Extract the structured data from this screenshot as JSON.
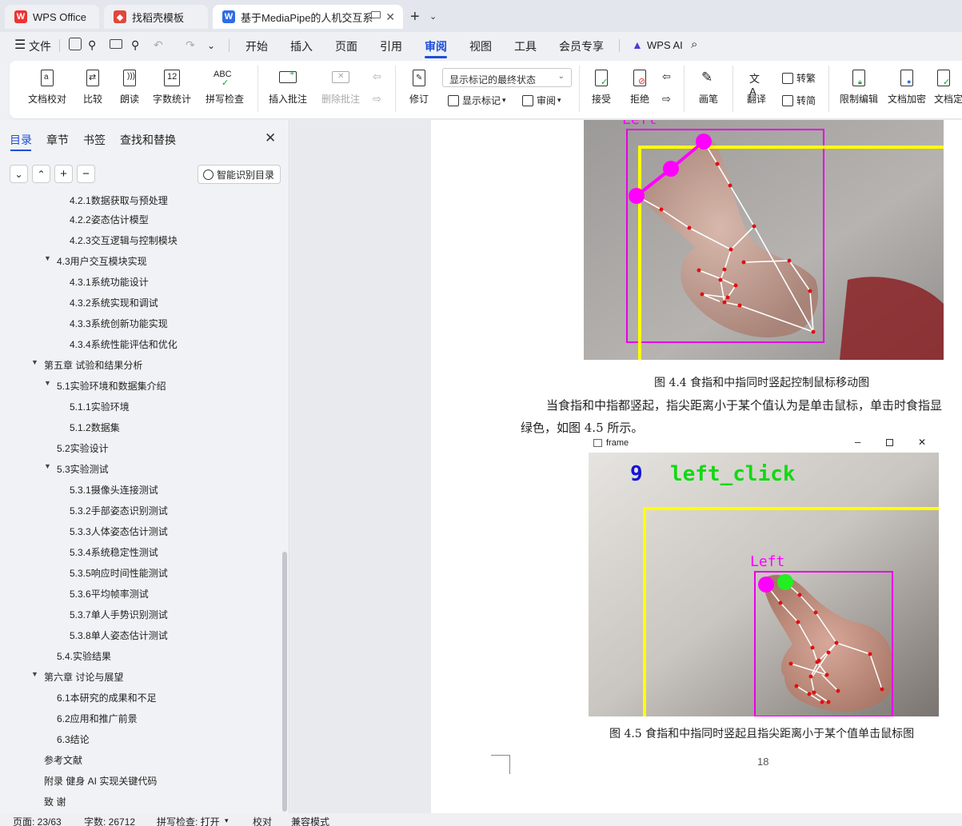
{
  "tabs": [
    {
      "label": "WPS Office",
      "icon": "wps-logo-icon"
    },
    {
      "label": "找稻壳模板",
      "icon": "docer-icon"
    },
    {
      "label": "基于MediaPipe的人机交互系",
      "icon": "word-doc-icon"
    }
  ],
  "menu": {
    "file": "文件",
    "items": [
      "开始",
      "插入",
      "页面",
      "引用",
      "审阅",
      "视图",
      "工具",
      "会员专享"
    ],
    "active": "审阅",
    "wps_ai": "WPS AI"
  },
  "ribbon": {
    "doc_check": "文档校对",
    "compare": "比较",
    "read_aloud": "朗读",
    "word_count": "字数统计",
    "spell_check": "拼写检查",
    "spell_icon_text": "ABC",
    "word_count_icon_text": "12",
    "insert_comment": "插入批注",
    "delete_comment": "删除批注",
    "track_changes": "修订",
    "display_mode": "显示标记的最终状态",
    "show_markup": "显示标记",
    "review": "审阅",
    "accept": "接受",
    "reject": "拒绝",
    "pen": "画笔",
    "translate": "翻译",
    "to_traditional": "转繁",
    "to_simplified": "转简",
    "restrict_edit": "限制编辑",
    "encrypt": "文档加密",
    "finalize": "文档定"
  },
  "side_panel": {
    "tabs": [
      "目录",
      "章节",
      "书签",
      "查找和替换"
    ],
    "active_tab": "目录",
    "smart_toc": "智能识别目录",
    "toc": [
      {
        "text": "4.2.1数据获取与预处理",
        "level": 3
      },
      {
        "text": "4.2.2姿态估计模型",
        "level": 3
      },
      {
        "text": "4.2.3交互逻辑与控制模块",
        "level": 3
      },
      {
        "text": "4.3用户交互模块实现",
        "level": 2,
        "expanded": true
      },
      {
        "text": "4.3.1系统功能设计",
        "level": 3
      },
      {
        "text": "4.3.2系统实现和调试",
        "level": 3
      },
      {
        "text": "4.3.3系统创新功能实现",
        "level": 3
      },
      {
        "text": "4.3.4系统性能评估和优化",
        "level": 3
      },
      {
        "text": "第五章 试验和结果分析",
        "level": 1,
        "expanded": true
      },
      {
        "text": "5.1实验环境和数据集介绍",
        "level": 2,
        "expanded": true
      },
      {
        "text": "5.1.1实验环境",
        "level": 3
      },
      {
        "text": "5.1.2数据集",
        "level": 3
      },
      {
        "text": "5.2实验设计",
        "level": 2
      },
      {
        "text": "5.3实验测试",
        "level": 2,
        "expanded": true
      },
      {
        "text": "5.3.1摄像头连接测试",
        "level": 3
      },
      {
        "text": "5.3.2手部姿态识别测试",
        "level": 3
      },
      {
        "text": "5.3.3人体姿态估计测试",
        "level": 3
      },
      {
        "text": "5.3.4系统稳定性测试",
        "level": 3
      },
      {
        "text": "5.3.5响应时间性能测试",
        "level": 3
      },
      {
        "text": "5.3.6平均帧率测试",
        "level": 3
      },
      {
        "text": "5.3.7单人手势识别测试",
        "level": 3
      },
      {
        "text": "5.3.8单人姿态估计测试",
        "level": 3
      },
      {
        "text": "5.4.实验结果",
        "level": 2
      },
      {
        "text": "第六章 讨论与展望",
        "level": 1,
        "expanded": true
      },
      {
        "text": "6.1本研究的成果和不足",
        "level": 2
      },
      {
        "text": "6.2应用和推广前景",
        "level": 2
      },
      {
        "text": "6.3结论",
        "level": 2
      },
      {
        "text": "参考文献",
        "level": 1
      },
      {
        "text": "附录 健身 AI 实现关键代码",
        "level": 1
      },
      {
        "text": "致 谢",
        "level": 1
      }
    ]
  },
  "document": {
    "fig1_label": "Left",
    "caption_1": "图 4.4 食指和中指同时竖起控制鼠标移动图",
    "paragraph_line1": "当食指和中指都竖起，指尖距离小于某个值认为是单击鼠标，单击时食指显",
    "paragraph_line2": "绿色，如图 4.5 所示。",
    "fig2_window_title": "frame",
    "fig2_count": "9",
    "fig2_action": "left_click",
    "fig2_label": "Left",
    "caption_2": "图 4.5 食指和中指同时竖起且指尖距离小于某个值单击鼠标图",
    "page_number": "18"
  },
  "status_bar": {
    "page": "页面: 23/63",
    "word_count": "字数: 26712",
    "spell_check": "拼写检查: 打开",
    "proofread": "校对",
    "compat_mode": "兼容模式"
  },
  "colors": {
    "accent": "#1d4fd8",
    "landmark_magenta": "#ff00ff",
    "bbox_yellow": "#ffff00",
    "click_green": "#00ff00"
  }
}
